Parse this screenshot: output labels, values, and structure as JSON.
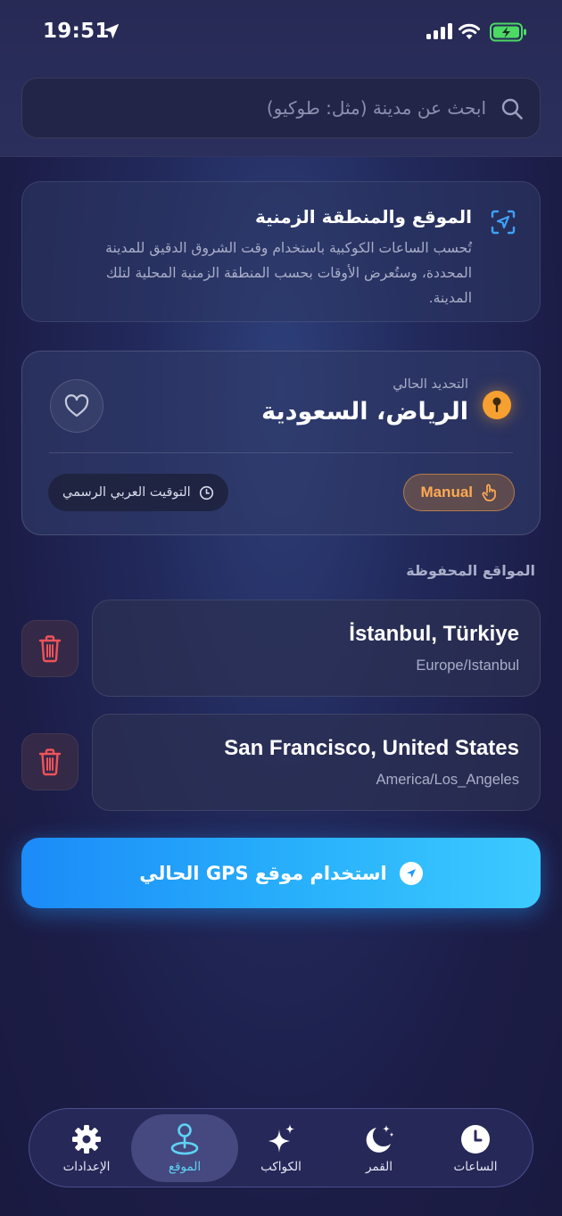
{
  "status_bar": {
    "time": "19:51"
  },
  "search": {
    "placeholder": "ابحث عن مدينة (مثل: طوكيو)"
  },
  "info_card": {
    "title": "الموقع والمنطقة الزمنية",
    "description": "تُحسب الساعات الكوكبية باستخدام وقت الشروق الدقيق للمدينة المحددة، وستُعرض الأوقات بحسب المنطقة الزمنية المحلية لتلك المدينة."
  },
  "current": {
    "label": "التحديد الحالي",
    "city": "الرياض، السعودية",
    "mode": "Manual",
    "timezone": "التوقيت العربي الرسمي"
  },
  "saved_section": {
    "title": "المواقع المحفوظة",
    "items": [
      {
        "name": "İstanbul, Türkiye",
        "tz": "Europe/Istanbul"
      },
      {
        "name": "San Francisco, United States",
        "tz": "America/Los_Angeles"
      }
    ]
  },
  "gps_button": {
    "label": "استخدام موقع GPS الحالي"
  },
  "tabbar": {
    "items": [
      {
        "label": "الإعدادات",
        "icon": "gear-icon"
      },
      {
        "label": "الموقع",
        "icon": "location-pin-icon",
        "active": true
      },
      {
        "label": "الكواكب",
        "icon": "sparkles-icon"
      },
      {
        "label": "القمر",
        "icon": "moon-icon"
      },
      {
        "label": "الساعات",
        "icon": "clock-icon"
      }
    ]
  },
  "colors": {
    "accent_orange": "#f6a031",
    "accent_blue": "#29b1fb",
    "delete_red": "#f0525a",
    "active_tab": "#5fd2f5"
  }
}
